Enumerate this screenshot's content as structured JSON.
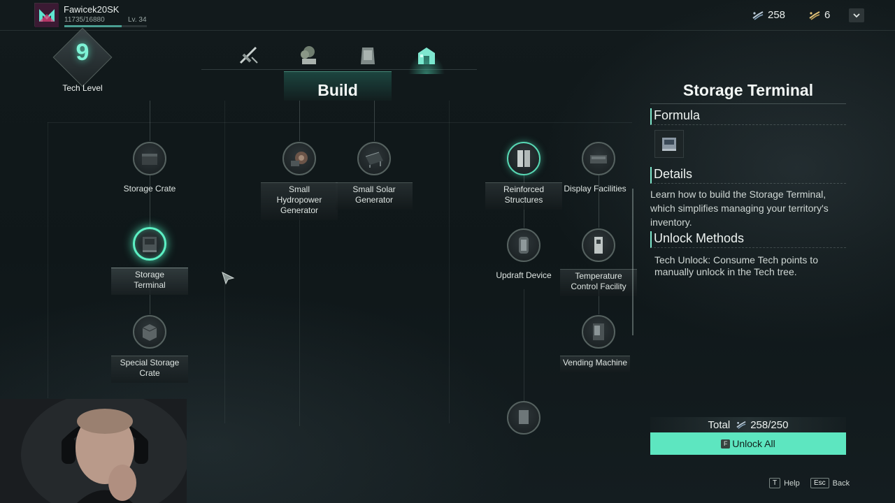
{
  "player": {
    "name": "Fawicek20SK",
    "xp": "11735/16880",
    "xp_fraction": 0.695,
    "level": "Lv. 34"
  },
  "currencies": [
    {
      "icon": "tech-point-icon",
      "value": "258"
    },
    {
      "icon": "ancient-tech-icon",
      "value": "6"
    }
  ],
  "tech_level": {
    "value": "9",
    "label": "Tech Level"
  },
  "tabs": [
    {
      "icon": "weapons-tab-icon",
      "active": false
    },
    {
      "icon": "farming-tab-icon",
      "active": false
    },
    {
      "icon": "gear-tab-icon",
      "active": false
    },
    {
      "icon": "build-tab-icon",
      "active": true
    }
  ],
  "category_title": "Build",
  "nodes": {
    "storage_crate": "Storage Crate",
    "storage_terminal": "Storage\nTerminal",
    "special_storage_crate": "Special Storage\nCrate",
    "small_hydropower": "Small\nHydropower\nGenerator",
    "small_solar": "Small Solar\nGenerator",
    "reinforced_structures": "Reinforced\nStructures",
    "display_facilities": "Display Facilities",
    "updraft_device": "Updraft Device",
    "temperature_control": "Temperature\nControl Facility",
    "vending_machine": "Vending Machine"
  },
  "detail": {
    "title": "Storage Terminal",
    "formula_heading": "Formula",
    "details_heading": "Details",
    "details_text": "Learn how to build the Storage Terminal, which simplifies managing your territory's inventory.",
    "unlock_heading": "Unlock Methods",
    "unlock_text": "Tech Unlock: Consume Tech points to manually unlock in the Tech tree."
  },
  "total": {
    "label": "Total",
    "value": "258/250"
  },
  "unlock_all": {
    "key": "F",
    "label": "Unlock All"
  },
  "hints": [
    {
      "key": "T",
      "label": "Help"
    },
    {
      "key": "Esc",
      "label": "Back"
    }
  ],
  "colors": {
    "accent": "#5de6c0",
    "glow": "#5cf0c4",
    "background": "#121a1c"
  }
}
